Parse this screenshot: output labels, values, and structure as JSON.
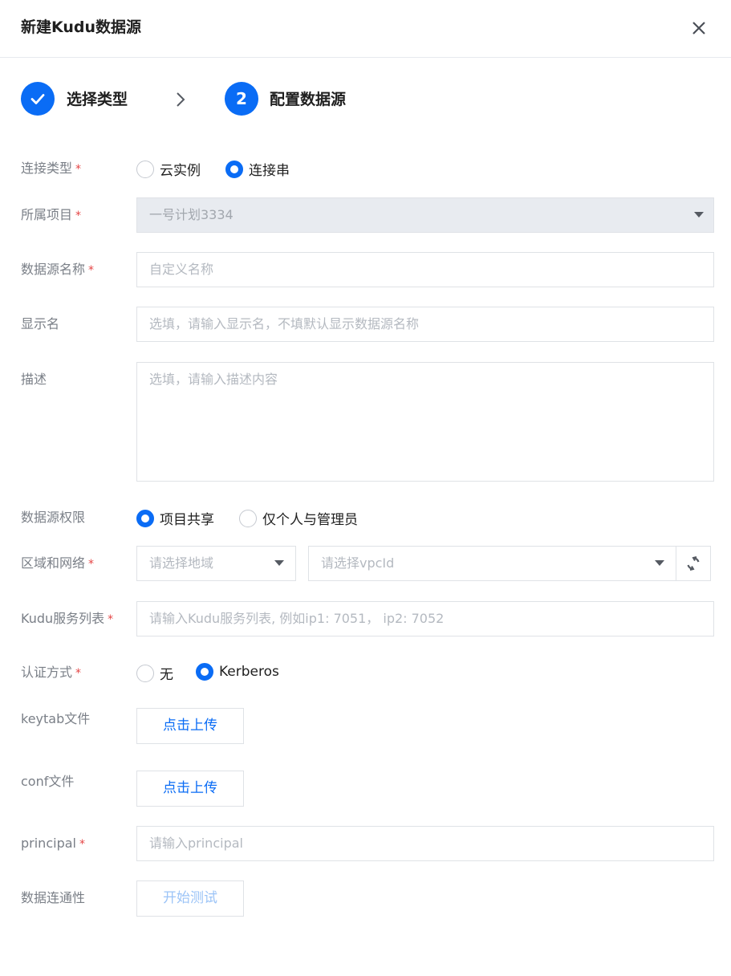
{
  "dialog": {
    "title": "新建Kudu数据源",
    "close_icon": "close-icon"
  },
  "steps": [
    {
      "label": "选择类型",
      "state": "done",
      "icon": "check-icon"
    },
    {
      "number": "2",
      "label": "配置数据源",
      "state": "active"
    }
  ],
  "required_mark": "*",
  "colors": {
    "accent": "#0a6cf5",
    "required": "#e54545"
  },
  "form": {
    "connection_type": {
      "label": "连接类型",
      "options": [
        "云实例",
        "连接串"
      ],
      "selected": "连接串"
    },
    "project": {
      "label": "所属项目",
      "value": "一号计划3334"
    },
    "datasource_name": {
      "label": "数据源名称",
      "placeholder": "自定义名称"
    },
    "display_name": {
      "label": "显示名",
      "placeholder": "选填，请输入显示名，不填默认显示数据源名称"
    },
    "description": {
      "label": "描述",
      "placeholder": "选填，请输入描述内容"
    },
    "permission": {
      "label": "数据源权限",
      "options": [
        "项目共享",
        "仅个人与管理员"
      ],
      "selected": "项目共享"
    },
    "region_network": {
      "label": "区域和网络",
      "region_placeholder": "请选择地域",
      "vpc_placeholder": "请选择vpcId",
      "refresh_icon": "refresh-icon"
    },
    "kudu_services": {
      "label": "Kudu服务列表",
      "placeholder": "请输入Kudu服务列表, 例如ip1: 7051， ip2: 7052"
    },
    "auth": {
      "label": "认证方式",
      "options": [
        "无",
        "Kerberos"
      ],
      "selected": "Kerberos"
    },
    "keytab": {
      "label": "keytab文件",
      "button": "点击上传"
    },
    "conf": {
      "label": "conf文件",
      "button": "点击上传"
    },
    "principal": {
      "label": "principal",
      "placeholder": "请输入principal"
    },
    "connectivity": {
      "label": "数据连通性",
      "button": "开始测试"
    }
  }
}
